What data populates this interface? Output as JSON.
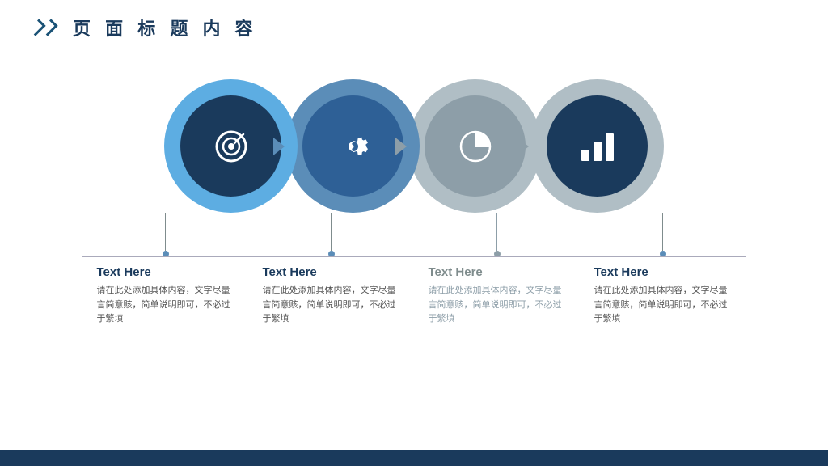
{
  "header": {
    "title": "页 面 标 题 内 容"
  },
  "circles": [
    {
      "id": 1,
      "color_outer": "#5dade2",
      "color_inner": "#1a3a5c",
      "icon": "target"
    },
    {
      "id": 2,
      "color_outer": "#5b8db8",
      "color_inner": "#2e6096",
      "icon": "gear"
    },
    {
      "id": 3,
      "color_outer": "#b0bec5",
      "color_inner": "#8d9ea8",
      "icon": "pie"
    },
    {
      "id": 4,
      "color_outer": "#b0bec5",
      "color_inner": "#1a3a5c",
      "icon": "bar"
    }
  ],
  "labels": [
    {
      "title": "Text Here",
      "desc": "请在此处添加具体内容，文字尽量言简意赅，简单说明即可，不必过于繁填",
      "gray": false
    },
    {
      "title": "Text Here",
      "desc": "请在此处添加具体内容，文字尽量言简意赅，简单说明即可，不必过于繁填",
      "gray": false
    },
    {
      "title": "Text Here",
      "desc": "请在此处添加具体内容，文字尽量言简意赅，简单说明即可，不必过于繁填",
      "gray": true
    },
    {
      "title": "Text Here",
      "desc": "请在此处添加具体内容，文字尽量言简意赅，简单说明即可，不必过于繁填",
      "gray": false
    }
  ]
}
